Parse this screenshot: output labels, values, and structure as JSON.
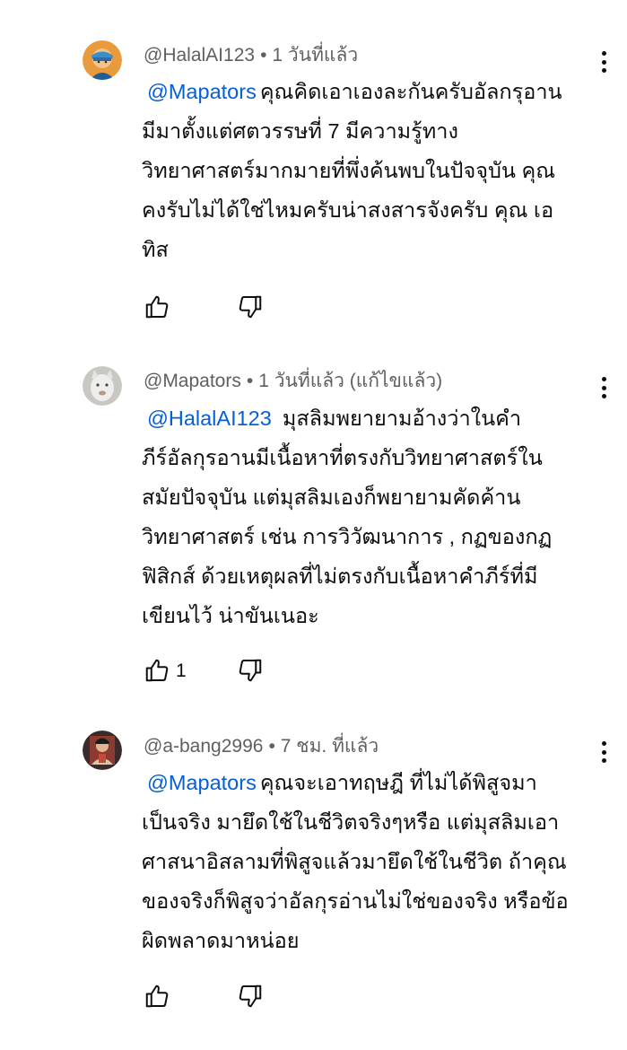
{
  "comments": [
    {
      "author": "@HalalAI123",
      "time": "1 วันที่แล้ว",
      "mention": "@Mapators",
      "text": "คุณคิดเอาเองละกันครับอัลกรุอานมีมาตั้งแต่ศตวรรษที่ 7 มีความรู้ทางวิทยาศาสตร์มากมายที่พึ่งค้นพบในปัจจุบัน คุณคงรับไม่ได้ใช่ไหมครับน่าสงสารจังครับ คุณ เอทิส",
      "lines": [
        "คุณคิดเอาเองละกันครับอัลกรุอาน",
        "มีมาตั้งแต่ศตวรรษที่ 7 มีความรู้ทาง",
        "วิทยาศาสตร์มากมายที่พึ่งค้นพบในปัจจุบัน คุณ",
        "คงรับไม่ได้ใช่ไหมครับน่าสงสารจังครับ คุณ เอ",
        "ทิส"
      ],
      "likes": ""
    },
    {
      "author": "@Mapators",
      "time": "1 วันที่แล้ว (แก้ไขแล้ว)",
      "mention": "@HalalAI123",
      "lines": [
        "มุสลิมพยายามอ้างว่าในคำ",
        "ภีร์อัลกุรอานมีเนื้อหาที่ตรงกับวิทยาศาสตร์ใน",
        "สมัยปัจจุบัน แต่มุสลิมเองก็พยายามคัดค้าน",
        "วิทยาศาสตร์ เช่น การวิวัฒนาการ , กฏของกฏ",
        "ฟิสิกส์ ด้วยเหตุผลที่ไม่ตรงกับเนื้อหาคำภีร์ที่มี",
        "เขียนไว้ น่าขันเนอะ"
      ],
      "likes": "1"
    },
    {
      "author": "@a-bang2996",
      "time": "7 ชม. ที่แล้ว",
      "mention": "@Mapators",
      "lines": [
        "คุณจะเอาทฤษฎี ที่ไม่ได้พิสูจมา",
        "เป็นจริง มายึดใช้ในชีวิตจริงๆหรือ แต่มุสลิมเอา",
        "ศาสนาอิสลามที่พิสูจแล้วมายึดใช้ในชีวิต ถ้าคุณ",
        "ของจริงก็พิสูจว่าอัลกุรอ่านไม่ใช่ของจริง หรือข้อ",
        "ผิดพลาดมาหน่อย"
      ],
      "likes": ""
    }
  ],
  "meta_separator": "•",
  "icons": {
    "like": "thumb-up-icon",
    "dislike": "thumb-down-icon",
    "more": "more-vert-icon"
  },
  "colors": {
    "mention": "#065fd4",
    "meta": "#606060",
    "text": "#0f0f0f"
  }
}
